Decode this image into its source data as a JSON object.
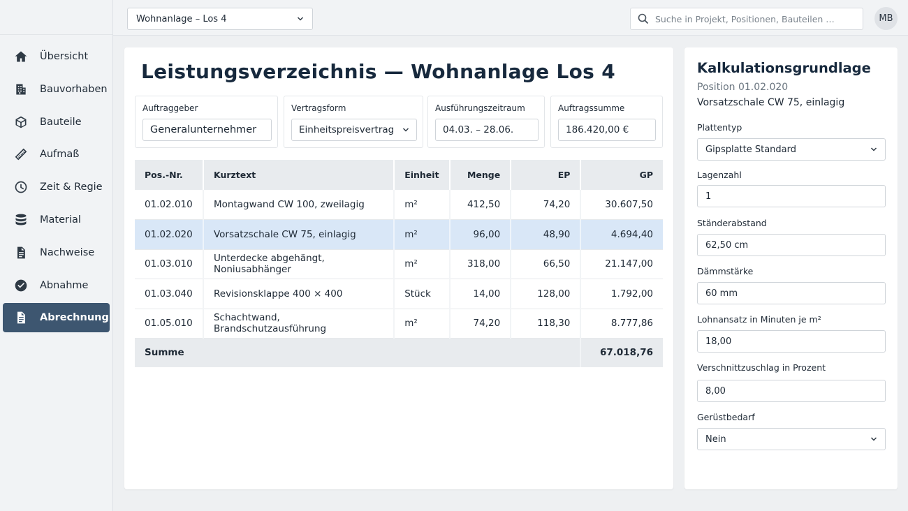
{
  "sidebar": {
    "items": [
      {
        "label": "Übersicht",
        "icon": "home-icon"
      },
      {
        "label": "Bauvorhaben",
        "icon": "building-icon"
      },
      {
        "label": "Bauteile",
        "icon": "cube-icon"
      },
      {
        "label": "Aufmaß",
        "icon": "ruler-icon"
      },
      {
        "label": "Zeit & Regie",
        "icon": "clock-icon"
      },
      {
        "label": "Material",
        "icon": "stack-icon"
      },
      {
        "label": "Nachweise",
        "icon": "document-icon"
      },
      {
        "label": "Abnahme",
        "icon": "check-circle-icon"
      },
      {
        "label": "Abrechnung",
        "icon": "invoice-icon"
      }
    ],
    "active_index": 8
  },
  "topbar": {
    "project_value": "Wohnanlage – Los 4",
    "search_placeholder": "Suche in Projekt, Positionen, Bauteilen …",
    "avatar_initials": "MB"
  },
  "main": {
    "title": "Leistungsverzeichnis — Wohnanlage Los 4",
    "info": {
      "client_label": "Auftraggeber",
      "client_value": "Generalunternehmer",
      "contract_label": "Vertragsform",
      "contract_value": "Einheitspreisvertrag",
      "period_label": "Ausführungszeitraum",
      "period_value": "04.03. – 28.06.",
      "sum_label": "Auftragssumme",
      "sum_value": "186.420,00 €"
    },
    "table": {
      "headers": {
        "pos": "Pos.-Nr.",
        "text": "Kurztext",
        "unit": "Einheit",
        "qty": "Menge",
        "ep": "EP",
        "gp": "GP"
      },
      "rows": [
        {
          "pos": "01.02.010",
          "text": "Montagwand CW 100, zweilagig",
          "unit": "m²",
          "qty": "412,50",
          "ep": "74,20",
          "gp": "30.607,50"
        },
        {
          "pos": "01.02.020",
          "text": "Vorsatzschale CW 75, einlagig",
          "unit": "m²",
          "qty": "96,00",
          "ep": "48,90",
          "gp": "4.694,40"
        },
        {
          "pos": "01.03.010",
          "text": "Unterdecke abgehängt, Noniusabhänger",
          "unit": "m²",
          "qty": "318,00",
          "ep": "66,50",
          "gp": "21.147,00"
        },
        {
          "pos": "01.03.040",
          "text": "Revisionsklappe 400 × 400",
          "unit": "Stück",
          "qty": "14,00",
          "ep": "128,00",
          "gp": "1.792,00"
        },
        {
          "pos": "01.05.010",
          "text": "Schachtwand, Brandschutzausführung",
          "unit": "m²",
          "qty": "74,20",
          "ep": "118,30",
          "gp": "8.777,86"
        }
      ],
      "selected_index": 1,
      "sum_label": "Summe",
      "sum_value": "67.018,76"
    }
  },
  "panel": {
    "title": "Kalkulationsgrundlage",
    "position": "Position 01.02.020",
    "position_text": "Vorsatzschale CW 75, einlagig",
    "fields": {
      "plate_label": "Plattentyp",
      "plate_value": "Gipsplatte Standard",
      "layers_label": "Lagenzahl",
      "layers_value": "1",
      "stud_label": "Ständerabstand",
      "stud_value": "62,50 cm",
      "insulation_label": "Dämmstärke",
      "insulation_value": "60 mm",
      "wage_label": "Lohnansatz in Minuten je m²",
      "wage_value": "18,00",
      "waste_label": "Verschnittzuschlag in Prozent",
      "waste_value": "8,00",
      "scaffold_label": "Gerüstbedarf",
      "scaffold_value": "Nein"
    }
  },
  "colors": {
    "active_nav": "#3d5670",
    "selected_row": "#d9e7f7",
    "header_bg": "#e8ebee"
  }
}
